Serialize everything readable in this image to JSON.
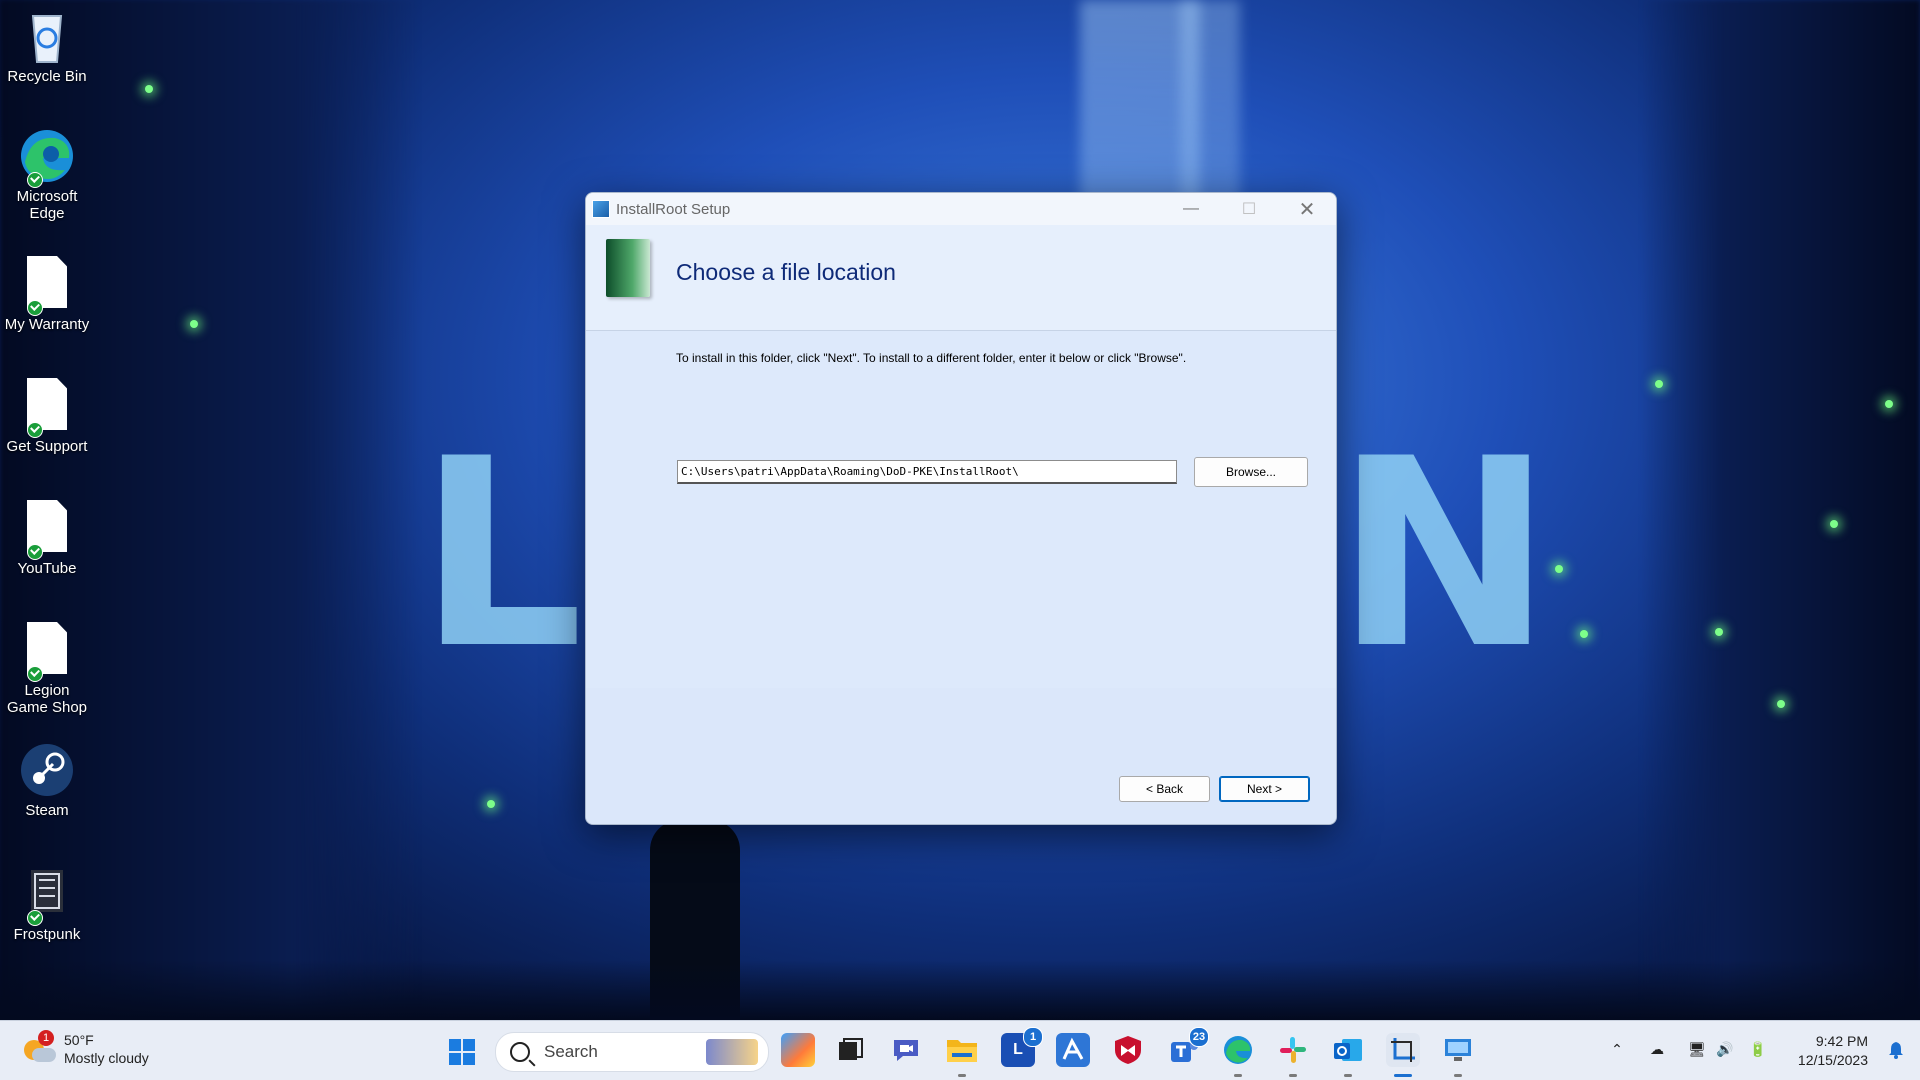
{
  "desktop": {
    "icons": [
      {
        "label": "Recycle Bin",
        "icon": "recycle-bin-icon"
      },
      {
        "label": "Microsoft Edge",
        "icon": "edge-icon"
      },
      {
        "label": "My Warranty",
        "icon": "document-icon"
      },
      {
        "label": "Get Support",
        "icon": "document-icon"
      },
      {
        "label": "YouTube",
        "icon": "document-icon"
      },
      {
        "label": "Legion Game Shop",
        "icon": "document-icon"
      },
      {
        "label": "Steam",
        "icon": "steam-icon"
      },
      {
        "label": "Frostpunk",
        "icon": "frostpunk-icon"
      }
    ]
  },
  "dialog": {
    "title": "InstallRoot Setup",
    "heading": "Choose a file location",
    "instruction": "To install in this folder, click \"Next\". To install to a different folder, enter it below or click \"Browse\".",
    "path_value": "C:\\Users\\patri\\AppData\\Roaming\\DoD-PKE\\InstallRoot\\",
    "browse_label": "Browse...",
    "back_label": "< Back",
    "next_label": "Next >"
  },
  "taskbar": {
    "weather": {
      "temp": "50°F",
      "condition": "Mostly cloudy",
      "badge": "1"
    },
    "search_label": "Search",
    "apps": [
      {
        "name": "copilot-app",
        "badge": ""
      },
      {
        "name": "task-view",
        "badge": ""
      },
      {
        "name": "teams-meet",
        "badge": ""
      },
      {
        "name": "file-explorer",
        "badge": ""
      },
      {
        "name": "lenovo-vantage",
        "badge": "1"
      },
      {
        "name": "app-a",
        "badge": ""
      },
      {
        "name": "mcafee",
        "badge": ""
      },
      {
        "name": "teams",
        "badge": "23"
      },
      {
        "name": "edge",
        "badge": ""
      },
      {
        "name": "slack",
        "badge": ""
      },
      {
        "name": "outlook-new",
        "badge": ""
      },
      {
        "name": "snipping-tool",
        "badge": ""
      },
      {
        "name": "remote-desktop",
        "badge": ""
      }
    ],
    "clock": {
      "time": "9:42 PM",
      "date": "12/15/2023"
    }
  },
  "colors": {
    "accent": "#0067c0",
    "heading": "#0e2a78",
    "taskbar_bg": "#e8edf6"
  }
}
